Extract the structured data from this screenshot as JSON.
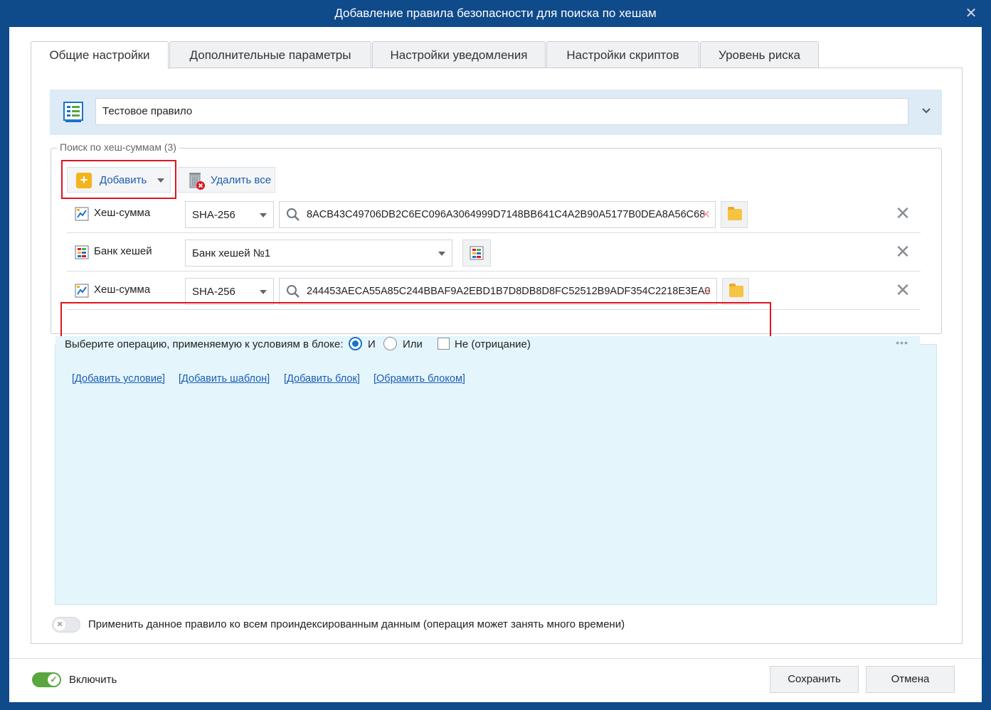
{
  "window": {
    "title": "Добавление правила безопасности для поиска по хешам",
    "close_glyph": "✕"
  },
  "tabs": [
    {
      "label": "Общие настройки",
      "active": true
    },
    {
      "label": "Дополнительные параметры",
      "active": false
    },
    {
      "label": "Настройки уведомления",
      "active": false
    },
    {
      "label": "Настройки скриптов",
      "active": false
    },
    {
      "label": "Уровень риска",
      "active": false
    }
  ],
  "rule": {
    "name": "Тестовое правило",
    "icon": "rule-list-icon"
  },
  "hash_search": {
    "group_title": "Поиск по хеш-суммам (3)",
    "add_label": "Добавить",
    "delete_all_label": "Удалить все",
    "clear_glyph": "✕",
    "remove_glyph": "✕",
    "rows": [
      {
        "type_label": "Хеш-сумма",
        "algorithm": "SHA-256",
        "hash": "8ACB43C49706DB2C6EC096A3064999D7148BB641C4A2B90A5177B0DEA8A56C68"
      },
      {
        "type_label": "Банк хешей",
        "bank": "Банк хешей №1"
      },
      {
        "type_label": "Хеш-сумма",
        "algorithm": "SHA-256",
        "hash": "244453AECA55A85C244BBAF9A2EBD1B7D8DB8D8FC52512B9ADF354C2218E3EA0"
      }
    ]
  },
  "conditions": {
    "lead": "Выберите операцию, применяемую к условиям в блоке:",
    "op_and": "И",
    "op_or": "Или",
    "negate": "Не (отрицание)",
    "selected_op": "И",
    "more_glyph": "•••",
    "links": [
      "[Добавить условие]",
      "[Добавить шаблон]",
      "[Добавить блок]",
      "[Обрамить блоком]"
    ]
  },
  "apply_all": {
    "label": "Применить данное правило ко всем проиндексированным данным (операция может занять много времени)",
    "enabled": false,
    "knob_glyph": "✕"
  },
  "footer": {
    "enable_label": "Включить",
    "enabled": true,
    "knob_glyph": "✓",
    "save_label": "Сохранить",
    "cancel_label": "Отмена"
  },
  "colors": {
    "titlebar": "#0f4a8a",
    "accent": "#1b73c8",
    "link": "#1b5db0",
    "highlight_box": "#e0141e",
    "toggle_on": "#5aa63f"
  }
}
